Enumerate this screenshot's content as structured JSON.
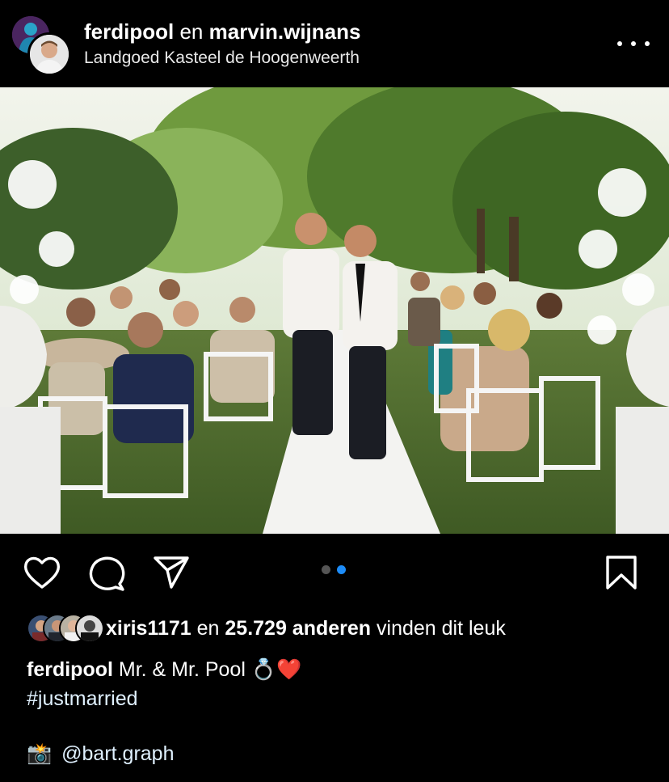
{
  "post": {
    "author": "ferdipool",
    "joiner": "en",
    "coauthor": "marvin.wijnans",
    "location": "Landgoed Kasteel de Hoogenweerth"
  },
  "icons": {
    "more": "more-horizontal-icon",
    "like": "heart-icon",
    "comment": "comment-bubble-icon",
    "share": "paper-plane-icon",
    "save": "bookmark-icon"
  },
  "carousel": {
    "total": 2,
    "active_index": 2
  },
  "likes": {
    "first_user": "xiris1171",
    "joiner": "en",
    "count_text": "25.729 anderen",
    "suffix": "vinden dit leuk"
  },
  "caption": {
    "username": "ferdipool",
    "text": "Mr. & Mr. Pool",
    "emoji": "💍❤️",
    "hashtag": "#justmarried",
    "camera_emoji": "📸",
    "mention": "@bart.graph"
  },
  "colors": {
    "background": "#000000",
    "active_dot": "#1d8cf8",
    "inactive_dot": "#555555"
  }
}
